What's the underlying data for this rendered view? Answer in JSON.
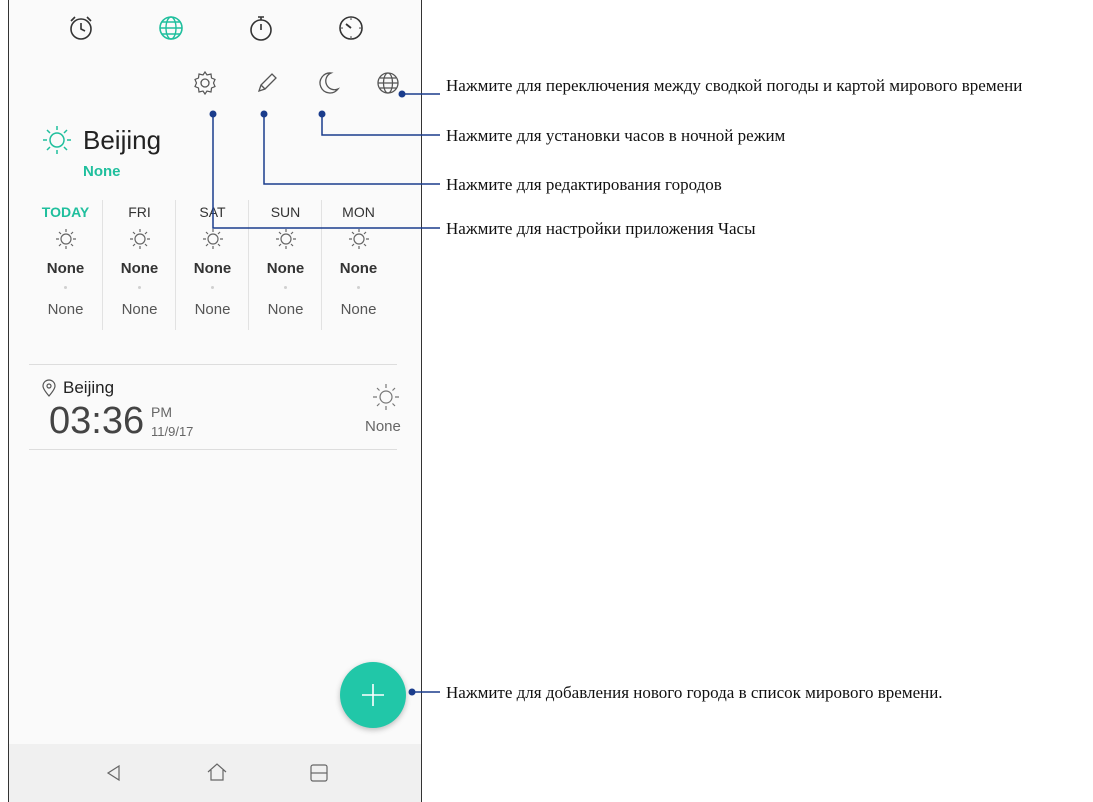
{
  "tabs": [
    {
      "name": "alarm-icon",
      "active": false
    },
    {
      "name": "globe-icon",
      "active": true
    },
    {
      "name": "stopwatch-icon",
      "active": false
    },
    {
      "name": "timer-icon",
      "active": false
    }
  ],
  "toolbar": [
    {
      "name": "settings-icon"
    },
    {
      "name": "pencil-icon"
    },
    {
      "name": "moon-icon"
    },
    {
      "name": "globe-icon"
    }
  ],
  "weather": {
    "city": "Beijing",
    "condition": "None",
    "forecast": [
      {
        "day": "TODAY",
        "high": "None",
        "low": "None"
      },
      {
        "day": "FRI",
        "high": "None",
        "low": "None"
      },
      {
        "day": "SAT",
        "high": "None",
        "low": "None"
      },
      {
        "day": "SUN",
        "high": "None",
        "low": "None"
      },
      {
        "day": "MON",
        "high": "None",
        "low": "None"
      }
    ]
  },
  "world_clock": [
    {
      "city": "Beijing",
      "time": "03:36",
      "ampm": "PM",
      "date": "11/9/17",
      "weather": "None"
    }
  ],
  "colors": {
    "accent": "#1fbf9d",
    "fab": "#21c7a8",
    "callout_line": "#1a3c8c"
  },
  "callouts": [
    "Нажмите для переключения между сводкой погоды и  картой мирового времени",
    "Нажмите для установки часов в ночной режим",
    "Нажмите для редактирования городов",
    "Нажмите для настройки приложения Часы",
    "Нажмите для добавления нового города в список мирового времени."
  ],
  "navbar": [
    {
      "name": "back-icon"
    },
    {
      "name": "home-icon"
    },
    {
      "name": "recents-icon"
    }
  ]
}
